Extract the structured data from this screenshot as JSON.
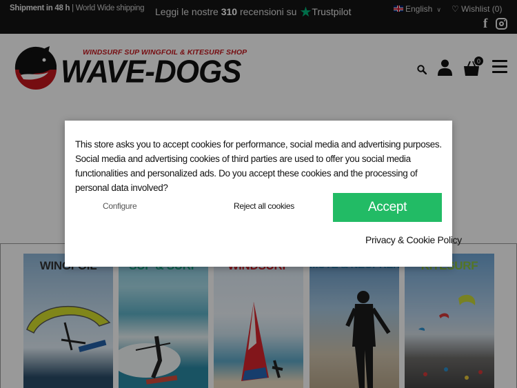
{
  "topbar": {
    "shipping_bold": "Shipment in 48 h",
    "shipping_rest": " | World Wide shipping",
    "review_prefix": "Leggi le nostre ",
    "review_count": "310",
    "review_suffix": " recensioni su",
    "trustpilot": "Trustpilot",
    "language": "English",
    "wishlist": "Wishlist (0)"
  },
  "header": {
    "logo_tagline": "WINDSURF SUP WINGFOIL & KITESURF SHOP",
    "logo_name": "WAVE-DOGS",
    "cart_count": "0"
  },
  "categories": [
    {
      "label": "WINGFOIL",
      "color": "#333333"
    },
    {
      "label": "SUP & SURF",
      "color": "#1aa886"
    },
    {
      "label": "WINDSURF",
      "color": "#d4202a"
    },
    {
      "label": "MUTE & NEOPRENE",
      "color": "#2a7fb0"
    },
    {
      "label": "KITESURF",
      "color": "#8ac43f"
    }
  ],
  "cookie_modal": {
    "message": "This store asks you to accept cookies for performance, social media and advertising purposes. Social media and advertising cookies of third parties are used to offer you social media functionalities and personalized ads. Do you accept these cookies and the processing of personal data involved?",
    "configure": "Configure",
    "reject": "Reject all cookies",
    "accept": "Accept",
    "policy": "Privacy & Cookie Policy",
    "accept_color": "#22bb65"
  }
}
